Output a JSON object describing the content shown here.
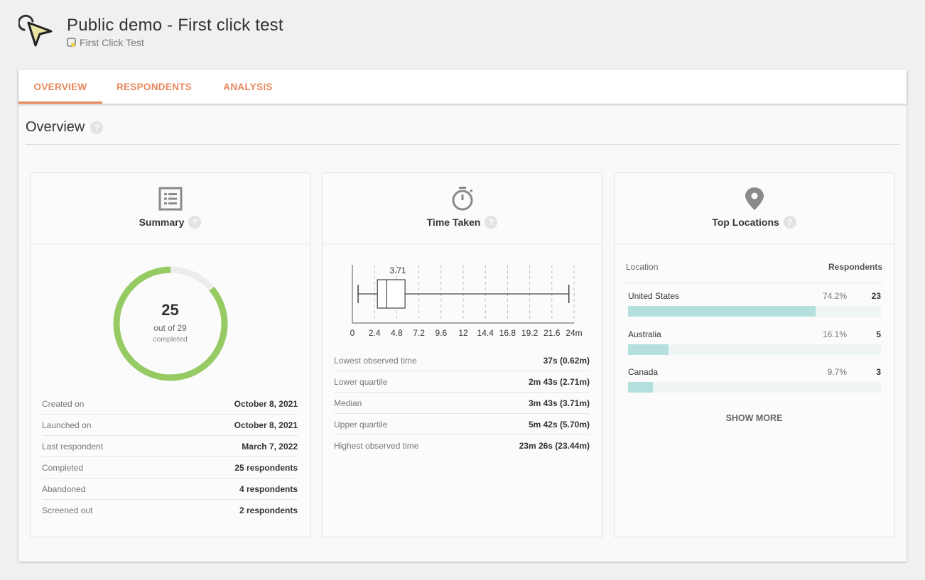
{
  "header": {
    "title": "Public demo - First click test",
    "subtitle": "First Click Test",
    "logo_icon": "cursor-click-icon"
  },
  "tabs": [
    {
      "label": "OVERVIEW",
      "active": true
    },
    {
      "label": "RESPONDENTS",
      "active": false
    },
    {
      "label": "ANALYSIS",
      "active": false
    }
  ],
  "section": {
    "title": "Overview",
    "help": "?"
  },
  "summary": {
    "title": "Summary",
    "icon": "list-icon",
    "completed": "25",
    "out_of": "out of 29",
    "completed_label": "completed",
    "completed_fraction": 0.862,
    "rows": [
      {
        "label": "Created on",
        "value": "October 8, 2021"
      },
      {
        "label": "Launched on",
        "value": "October 8, 2021"
      },
      {
        "label": "Last respondent",
        "value": "March 7, 2022"
      },
      {
        "label": "Completed",
        "value": "25 respondents"
      },
      {
        "label": "Abandoned",
        "value": "4 respondents"
      },
      {
        "label": "Screened out",
        "value": "2 respondents"
      }
    ]
  },
  "time_taken": {
    "title": "Time Taken",
    "icon": "stopwatch-icon",
    "rows": [
      {
        "label": "Lowest observed time",
        "value": "37s (0.62m)"
      },
      {
        "label": "Lower quartile",
        "value": "2m 43s (2.71m)"
      },
      {
        "label": "Median",
        "value": "3m 43s (3.71m)"
      },
      {
        "label": "Upper quartile",
        "value": "5m 42s (5.70m)"
      },
      {
        "label": "Highest observed time",
        "value": "23m 26s (23.44m)"
      }
    ]
  },
  "chart_data": {
    "type": "box",
    "min": 0.62,
    "q1": 2.71,
    "median": 3.71,
    "q3": 5.7,
    "max": 23.44,
    "median_label": "3.71",
    "ticks": [
      "0",
      "2.4",
      "4.8",
      "7.2",
      "9.6",
      "12",
      "14.4",
      "16.8",
      "19.2",
      "21.6",
      "24m"
    ],
    "xlim": [
      0,
      24
    ],
    "grid": "vertical dashed"
  },
  "locations": {
    "title": "Top Locations",
    "icon": "map-pin-icon",
    "col_location": "Location",
    "col_respondents": "Respondents",
    "items": [
      {
        "name": "United States",
        "pct": "74.2%",
        "count": "23",
        "fraction": 0.742
      },
      {
        "name": "Australia",
        "pct": "16.1%",
        "count": "5",
        "fraction": 0.161
      },
      {
        "name": "Canada",
        "pct": "9.7%",
        "count": "3",
        "fraction": 0.097
      }
    ],
    "show_more": "SHOW MORE"
  },
  "colors": {
    "accent": "#e8875b",
    "donut": "#96cb64",
    "donut_track": "#ececec",
    "bar_fill": "#b3dfdc",
    "bar_track": "#eef5f4"
  }
}
